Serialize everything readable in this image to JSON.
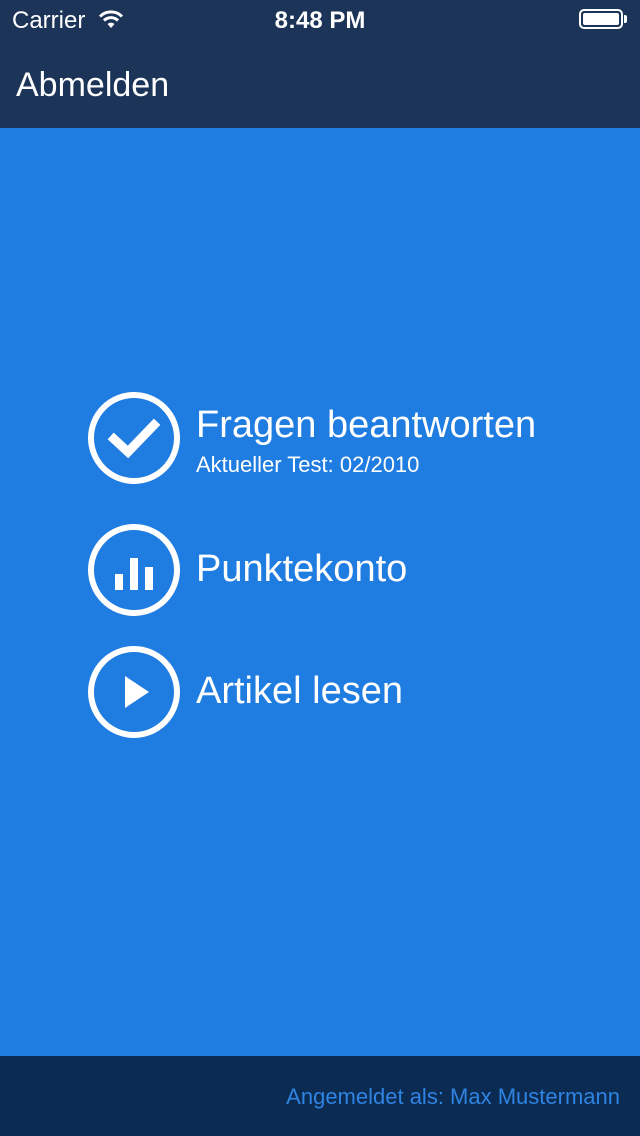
{
  "status_bar": {
    "carrier": "Carrier",
    "time": "8:48 PM",
    "wifi_icon": "wifi-icon",
    "battery_icon": "battery-icon"
  },
  "nav": {
    "logout_label": "Abmelden"
  },
  "menu": {
    "items": [
      {
        "label": "Fragen beantworten",
        "sublabel": "Aktueller Test: 02/2010",
        "icon": "checkmark-icon"
      },
      {
        "label": "Punktekonto",
        "icon": "bar-chart-icon"
      },
      {
        "label": "Artikel lesen",
        "icon": "play-icon"
      }
    ]
  },
  "footer": {
    "logged_in_text": "Angemeldet als: Max Mustermann"
  },
  "colors": {
    "background": "#1f7ce0",
    "topbar": "#1b3457",
    "footer": "#0c2b52",
    "footer_text": "#2f83e2"
  }
}
